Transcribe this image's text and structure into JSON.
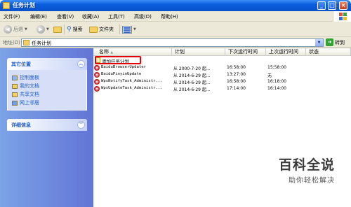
{
  "window": {
    "title": "任务计划"
  },
  "menu": [
    "文件(F)",
    "编辑(E)",
    "查看(V)",
    "收藏(A)",
    "工具(T)",
    "高级(D)",
    "帮助(H)"
  ],
  "toolbar": {
    "back": "后退",
    "search": "搜索",
    "folders": "文件夹"
  },
  "address": {
    "label": "地址(D)",
    "value": "任务计划",
    "go": "转到"
  },
  "sidebar": {
    "other_places": {
      "title": "其它位置",
      "links": [
        "控制面板",
        "我的文档",
        "共享文档",
        "网上邻居"
      ]
    },
    "details": {
      "title": "详细信息"
    }
  },
  "columns": {
    "name": "名称",
    "schedule": "计划",
    "next_run": "下次运行时间",
    "last_run": "上次运行时间",
    "status": "状态"
  },
  "rows": [
    {
      "name": "添加任务计划",
      "schedule": "",
      "next_run": "",
      "last_run": ""
    },
    {
      "name": "BaiduBrowserUpdater",
      "schedule": "从 2000-7-20 起...",
      "next_run": "16:58:00",
      "last_run": "15:58:00"
    },
    {
      "name": "BaiduPinyinUpdate",
      "schedule": "从 2014-6-29 起...",
      "next_run": "13:27:00",
      "last_run": "无"
    },
    {
      "name": "WpsNotifyTask_Administr...",
      "schedule": "从 2014-6-29 起...",
      "next_run": "16:58:00",
      "last_run": "16:18:00"
    },
    {
      "name": "WpsUpdateTask_Administr...",
      "schedule": "从 2014-6-29 起...",
      "next_run": "17:14:00",
      "last_run": "16:14:00"
    }
  ],
  "watermark": {
    "title": "百科全说",
    "subtitle": "助你轻松解决"
  }
}
